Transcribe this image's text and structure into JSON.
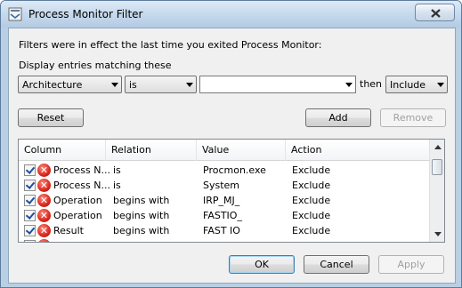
{
  "window": {
    "title": "Process Monitor Filter"
  },
  "intro_text": "Filters were in effect the last time you exited Process Monitor:",
  "match_label": "Display entries matching these",
  "criteria": {
    "field": "Architecture",
    "relation": "is",
    "value": "",
    "then_label": "then",
    "action": "Include"
  },
  "buttons": {
    "reset": "Reset",
    "add": "Add",
    "remove": "Remove",
    "ok": "OK",
    "cancel": "Cancel",
    "apply": "Apply"
  },
  "table": {
    "columns": [
      "Column",
      "Relation",
      "Value",
      "Action"
    ],
    "rows": [
      {
        "column": "Process N...",
        "relation": "is",
        "value": "Procmon.exe",
        "action": "Exclude"
      },
      {
        "column": "Process N...",
        "relation": "is",
        "value": "System",
        "action": "Exclude"
      },
      {
        "column": "Operation",
        "relation": "begins with",
        "value": "IRP_MJ_",
        "action": "Exclude"
      },
      {
        "column": "Operation",
        "relation": "begins with",
        "value": "FASTIO_",
        "action": "Exclude"
      },
      {
        "column": "Result",
        "relation": "begins with",
        "value": "FAST IO",
        "action": "Exclude"
      }
    ]
  },
  "icons": {
    "close": "close-icon",
    "app": "filter-app-icon",
    "exclude": "red-x-icon"
  }
}
